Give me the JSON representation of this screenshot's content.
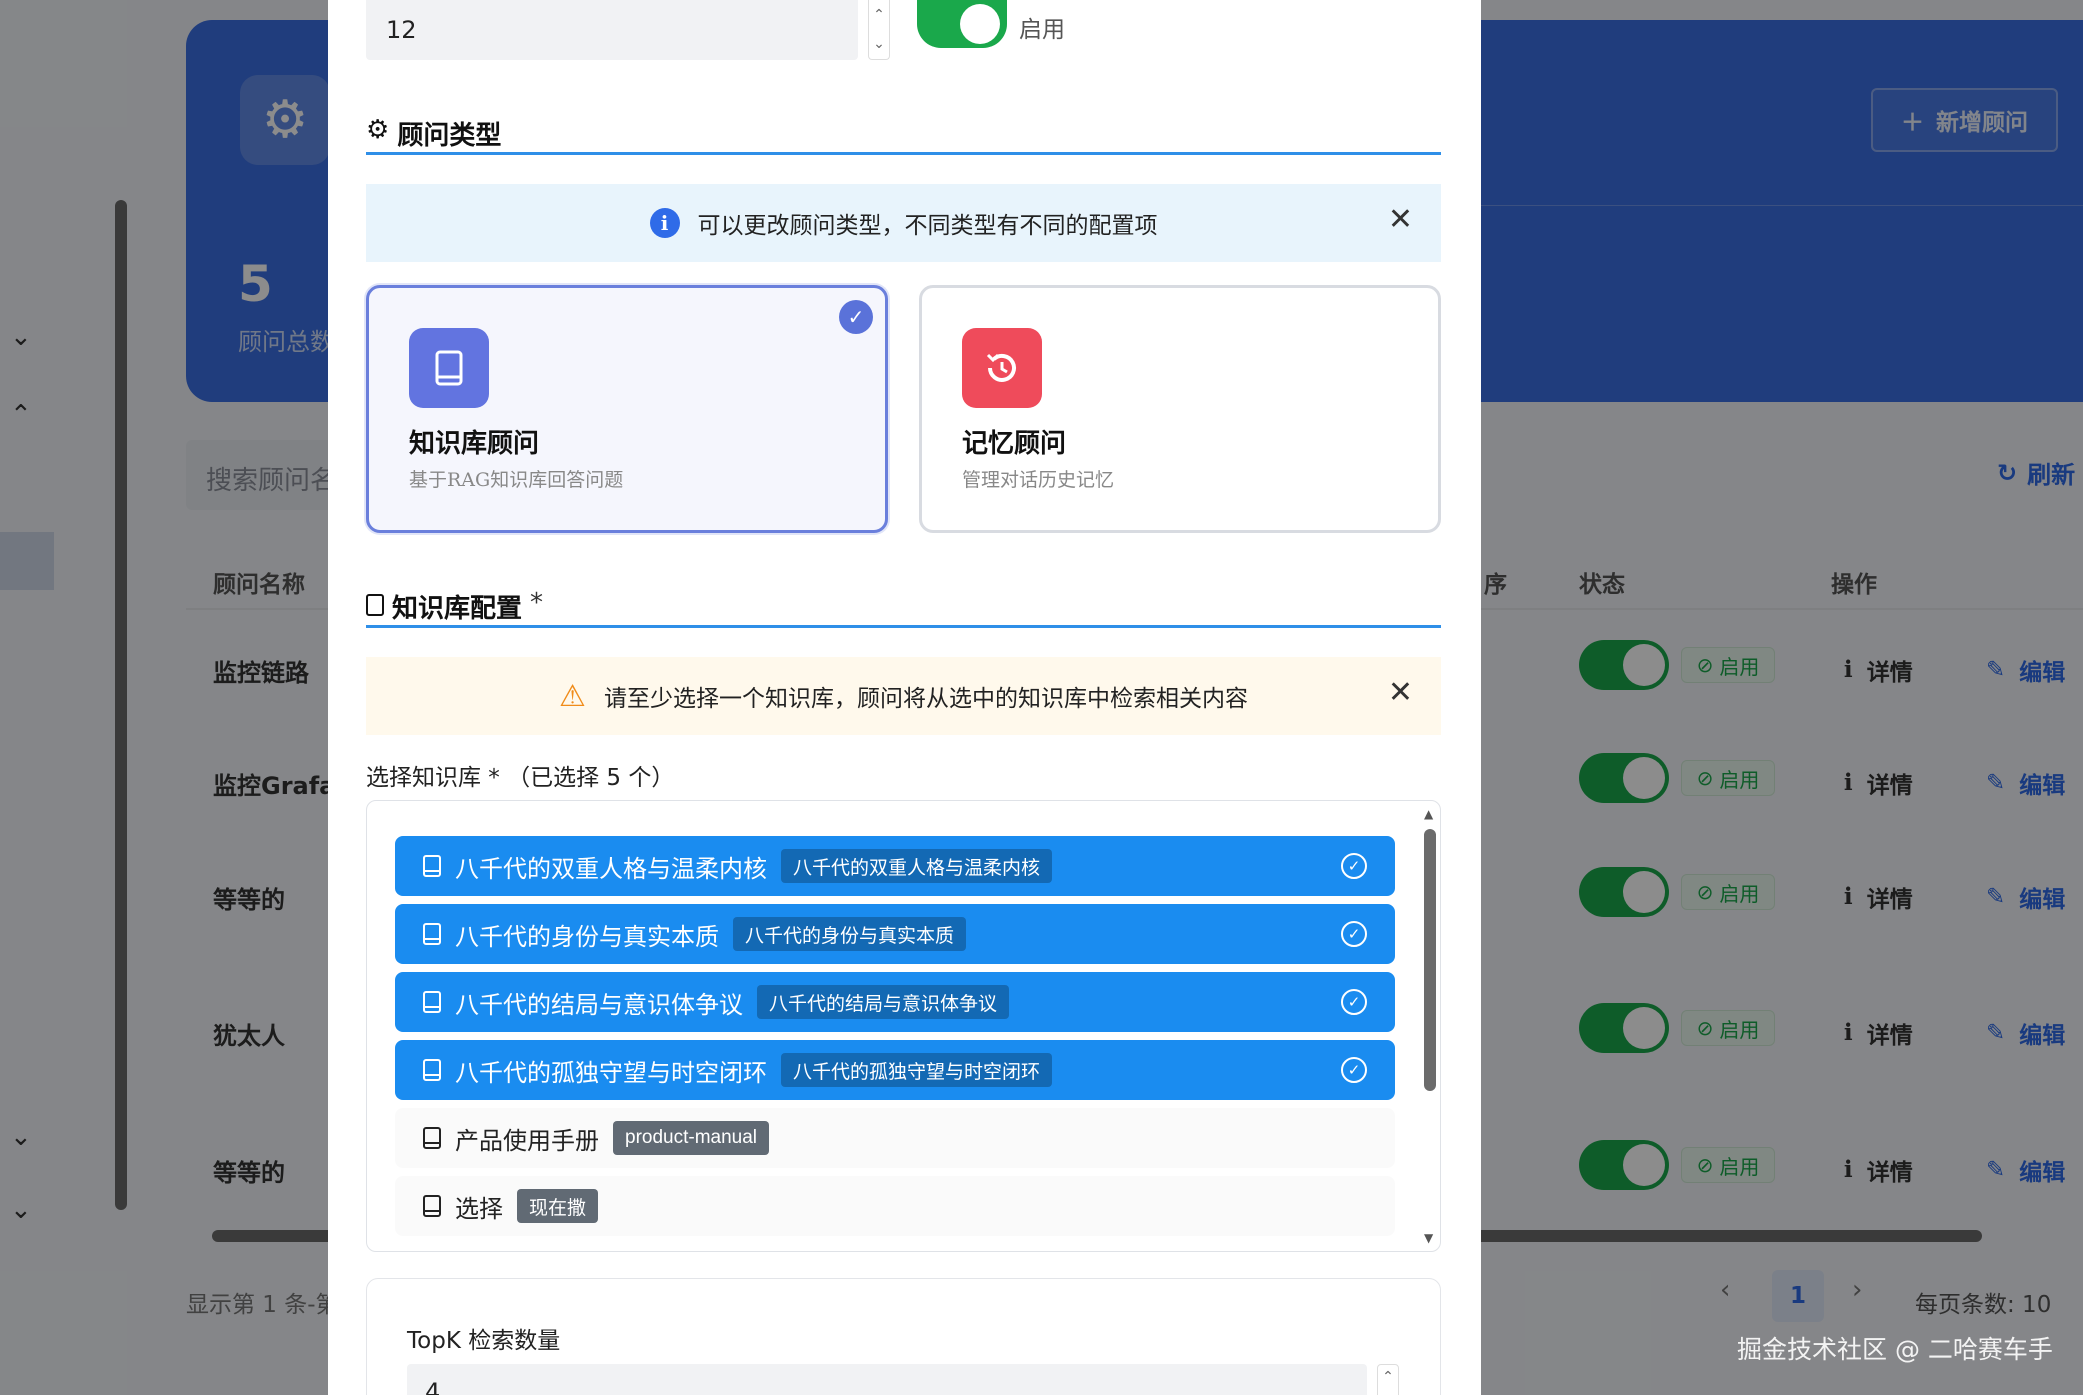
{
  "background": {
    "hero": {
      "count": "5",
      "count_label": "顾问总数",
      "add_button": "新增顾问"
    },
    "search_placeholder": "搜索顾问名",
    "refresh_label": "刷新",
    "table": {
      "headers": {
        "name": "顾问名称",
        "order": "序",
        "status": "状态",
        "actions": "操作"
      },
      "rows": [
        {
          "name": "监控链路"
        },
        {
          "name": "监控Grafan"
        },
        {
          "name": "等等的"
        },
        {
          "name": "犹太人"
        },
        {
          "name": "等等的"
        }
      ],
      "status_on_label": "启用",
      "detail_label": "详情",
      "edit_label": "编辑"
    },
    "paging_text": "显示第 1 条-第",
    "current_page": "1",
    "per_page_label": "每页条数: 10"
  },
  "watermark": "掘金技术社区 @ 二哈赛车手",
  "modal": {
    "top_number_value": "12",
    "enable_label": "启用",
    "advisor_type": {
      "title": "顾问类型",
      "info_text": "可以更改顾问类型，不同类型有不同的配置项",
      "cards": [
        {
          "name": "知识库顾问",
          "desc": "基于RAG知识库回答问题",
          "selected": true,
          "color": "#6274e0"
        },
        {
          "name": "记忆顾问",
          "desc": "管理对话历史记忆",
          "selected": false,
          "color": "#ef4b5b"
        }
      ]
    },
    "kb_config": {
      "title": "知识库配置",
      "required_mark": "*",
      "warning_text": "请至少选择一个知识库，顾问将从选中的知识库中检索相关内容",
      "select_label": "选择知识库 * （已选择 5 个）",
      "items": [
        {
          "name": "八千代的双重人格与温柔内核",
          "tag": "八千代的双重人格与温柔内核",
          "selected": true
        },
        {
          "name": "八千代的身份与真实本质",
          "tag": "八千代的身份与真实本质",
          "selected": true
        },
        {
          "name": "八千代的结局与意识体争议",
          "tag": "八千代的结局与意识体争议",
          "selected": true
        },
        {
          "name": "八千代的孤独守望与时空闭环",
          "tag": "八千代的孤独守望与时空闭环",
          "selected": true
        },
        {
          "name": "产品使用手册",
          "tag": "product-manual",
          "selected": false
        },
        {
          "name": "选择",
          "tag": "现在撒",
          "selected": false
        }
      ]
    },
    "topk": {
      "label": "TopK 检索数量",
      "value": "4"
    }
  }
}
